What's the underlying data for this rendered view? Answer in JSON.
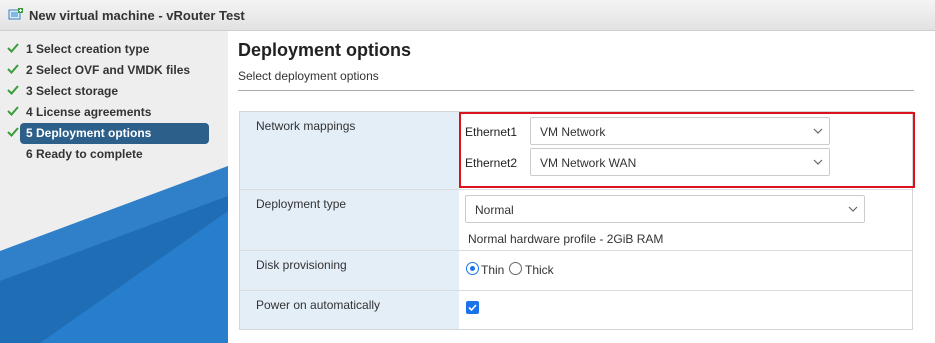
{
  "window": {
    "title": "New virtual machine - vRouter Test",
    "icon": "vm-add-icon"
  },
  "sidebar": {
    "steps": [
      {
        "label": "1 Select creation type",
        "done": true,
        "active": false
      },
      {
        "label": "2 Select OVF and VMDK files",
        "done": true,
        "active": false
      },
      {
        "label": "3 Select storage",
        "done": true,
        "active": false
      },
      {
        "label": "4 License agreements",
        "done": true,
        "active": false
      },
      {
        "label": "5 Deployment options",
        "done": true,
        "active": true
      },
      {
        "label": "6 Ready to complete",
        "done": false,
        "active": false
      }
    ],
    "accent_color": "#2c5f8a"
  },
  "main": {
    "title": "Deployment options",
    "subtitle": "Select deployment options",
    "network_mappings": {
      "label": "Network mappings",
      "entries": [
        {
          "name": "Ethernet1",
          "value": "VM Network"
        },
        {
          "name": "Ethernet2",
          "value": "VM Network WAN"
        }
      ],
      "highlight_color": "#d8131b"
    },
    "deployment_type": {
      "label": "Deployment type",
      "value": "Normal",
      "description": "Normal hardware profile - 2GiB RAM"
    },
    "disk_provisioning": {
      "label": "Disk provisioning",
      "options": [
        {
          "label": "Thin",
          "selected": true
        },
        {
          "label": "Thick",
          "selected": false
        }
      ]
    },
    "power_on": {
      "label": "Power on automatically",
      "checked": true
    }
  }
}
